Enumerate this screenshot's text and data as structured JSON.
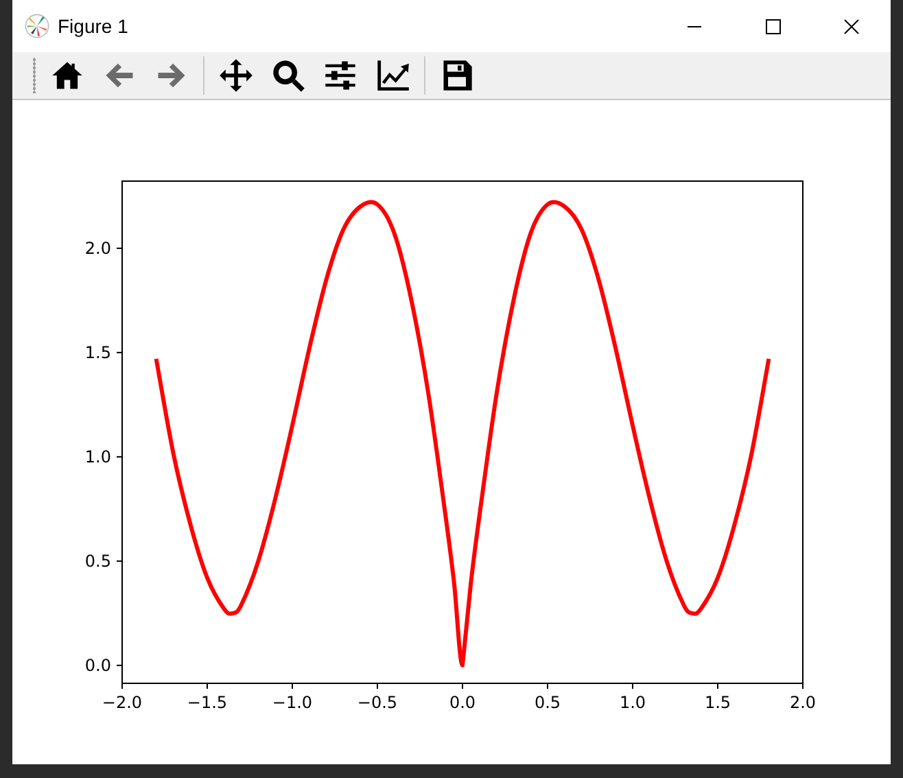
{
  "window": {
    "title": "Figure 1"
  },
  "toolbar": [
    {
      "kind": "home",
      "disabled": false
    },
    {
      "kind": "back",
      "disabled": true
    },
    {
      "kind": "forward",
      "disabled": true
    },
    {
      "kind": "separator"
    },
    {
      "kind": "pan",
      "disabled": false
    },
    {
      "kind": "zoom",
      "disabled": false
    },
    {
      "kind": "configure",
      "disabled": false
    },
    {
      "kind": "edit",
      "disabled": false
    },
    {
      "kind": "separator"
    },
    {
      "kind": "save",
      "disabled": false
    }
  ],
  "chart_data": {
    "type": "line",
    "xlim": [
      -2,
      2
    ],
    "ylim": [
      -0.086,
      2.322
    ],
    "xticks": [
      {
        "value": -2,
        "label": "−2.0"
      },
      {
        "value": -1.5,
        "label": "−1.5"
      },
      {
        "value": -1,
        "label": "−1.0"
      },
      {
        "value": -0.5,
        "label": "−0.5"
      },
      {
        "value": 0,
        "label": "0.0"
      },
      {
        "value": 0.5,
        "label": "0.5"
      },
      {
        "value": 1,
        "label": "1.0"
      },
      {
        "value": 1.5,
        "label": "1.5"
      },
      {
        "value": 2,
        "label": "2.0"
      }
    ],
    "yticks": [
      {
        "value": 0,
        "label": "0.0"
      },
      {
        "value": 0.5,
        "label": "0.5"
      },
      {
        "value": 1,
        "label": "1.0"
      },
      {
        "value": 1.5,
        "label": "1.5"
      },
      {
        "value": 2,
        "label": "2.0"
      }
    ],
    "x": [
      -1.8,
      -1.7,
      -1.6,
      -1.5,
      -1.4,
      -1.35,
      -1.3,
      -1.2,
      -1.1,
      -1.0,
      -0.9,
      -0.8,
      -0.7,
      -0.6,
      -0.5,
      -0.4,
      -0.3,
      -0.2,
      -0.1,
      -0.05,
      0,
      0.05,
      0.1,
      0.2,
      0.3,
      0.4,
      0.5,
      0.6,
      0.7,
      0.8,
      0.9,
      1.0,
      1.1,
      1.2,
      1.3,
      1.35,
      1.4,
      1.5,
      1.6,
      1.7,
      1.8
    ],
    "series": [
      {
        "color": "#ff0000",
        "values": [
          1.47,
          1.02,
          0.68,
          0.42,
          0.27,
          0.25,
          0.29,
          0.5,
          0.8,
          1.15,
          1.52,
          1.85,
          2.09,
          2.2,
          2.21,
          2.07,
          1.75,
          1.3,
          0.72,
          0.4,
          0,
          0.4,
          0.72,
          1.3,
          1.75,
          2.07,
          2.21,
          2.2,
          2.09,
          1.85,
          1.52,
          1.15,
          0.8,
          0.5,
          0.29,
          0.25,
          0.27,
          0.42,
          0.68,
          1.02,
          1.47
        ]
      }
    ]
  }
}
